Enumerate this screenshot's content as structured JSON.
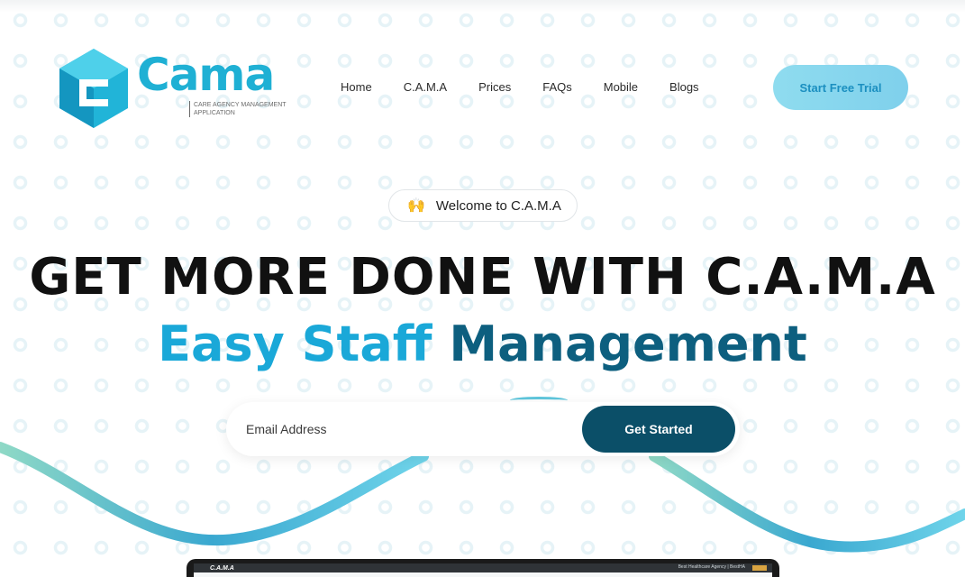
{
  "logo": {
    "name": "Cama",
    "subtitle": "CARE AGENCY MANAGEMENT APPLICATION"
  },
  "nav": {
    "items": [
      "Home",
      "C.A.M.A",
      "Prices",
      "FAQs",
      "Mobile",
      "Blogs"
    ],
    "cta_label": "Start Free Trial"
  },
  "hero": {
    "badge_text": "Welcome to C.A.M.A",
    "badge_icon": "raised-hands-icon",
    "headline": "GET MORE DONE WITH C.A.M.A",
    "subheadline_part1": "Easy Staff",
    "subheadline_part2": "Management"
  },
  "signup": {
    "email_placeholder": "Email Address",
    "button_label": "Get Started"
  },
  "preview": {
    "title": "C.A.M.A",
    "agency_name": "Best Healthcare Agency | BestHA"
  },
  "colors": {
    "brand_primary": "#1aa8d8",
    "brand_dark": "#0b4f68",
    "cta_bg": "#8fdcef"
  }
}
